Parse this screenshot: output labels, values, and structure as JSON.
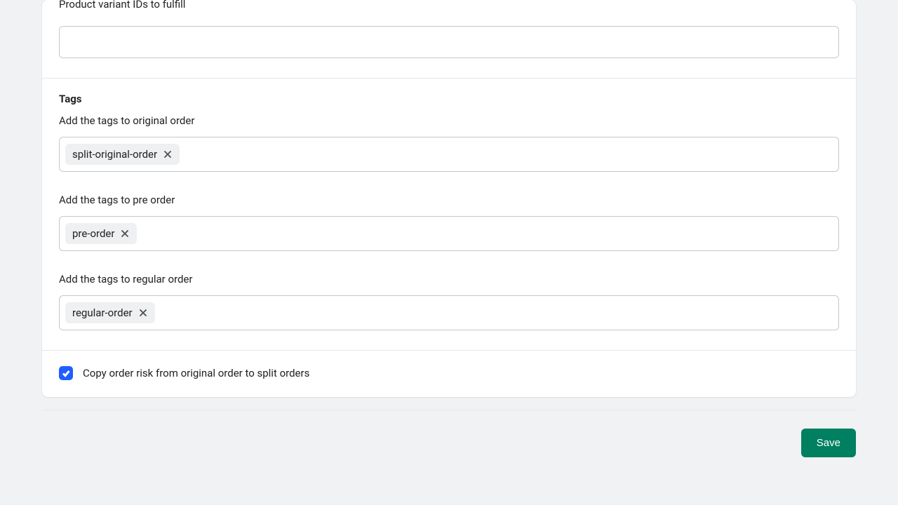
{
  "variant_section": {
    "label": "Product variant IDs to fulfill",
    "value": ""
  },
  "tags": {
    "heading": "Tags",
    "original": {
      "label": "Add the tags to original order",
      "tags": [
        "split-original-order"
      ]
    },
    "preorder": {
      "label": "Add the tags to pre order",
      "tags": [
        "pre-order"
      ]
    },
    "regular": {
      "label": "Add the tags to regular order",
      "tags": [
        "regular-order"
      ]
    }
  },
  "copy_risk": {
    "checked": true,
    "label": "Copy order risk from original order to split orders"
  },
  "footer": {
    "save_label": "Save"
  }
}
